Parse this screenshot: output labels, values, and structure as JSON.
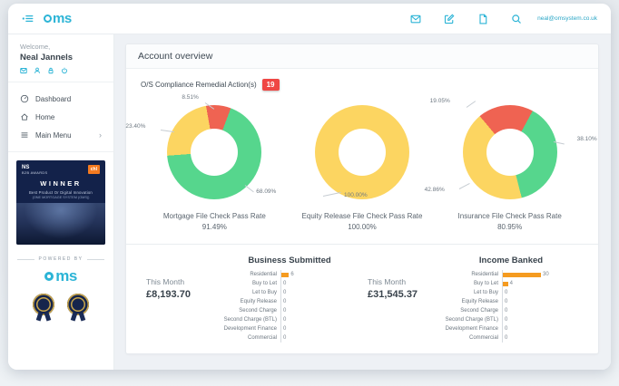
{
  "brand": {
    "o": "o",
    "ms": "ms"
  },
  "topbar": {
    "email": "neal@omsystem.co.uk"
  },
  "sidebar": {
    "welcome": "Welcome,",
    "username": "Neal Jannels",
    "nav": [
      {
        "label": "Dashboard"
      },
      {
        "label": "Home"
      },
      {
        "label": "Main Menu",
        "chevron": "›"
      }
    ],
    "award_banner": {
      "org": "NS",
      "org_sub": "B2B AWARDS",
      "sponsor": "chl",
      "winner": "WINNER",
      "category": "Best Product Or Digital Innovation",
      "product": "(ONE MORTGAGE SYSTEM (OMS))"
    },
    "powered_by": "POWERED BY"
  },
  "main": {
    "page_title": "Account overview",
    "compliance_label": "O/S Compliance Remedial Action(s)",
    "compliance_count": "19"
  },
  "chart_data": {
    "donuts": [
      {
        "type": "pie",
        "title": "Mortgage File Check Pass Rate",
        "value": "91.49%",
        "rotation": -10,
        "segments": [
          {
            "label": "8.51%",
            "value": 8.51,
            "color": "#ef6352"
          },
          {
            "label": "68.09%",
            "value": 68.09,
            "color": "#56d68d"
          },
          {
            "label": "23.40%",
            "value": 23.4,
            "color": "#fcd561"
          }
        ]
      },
      {
        "type": "pie",
        "title": "Equity Release File Check Pass Rate",
        "value": "100.00%",
        "rotation": 0,
        "segments": [
          {
            "label": "100.00%",
            "value": 100,
            "color": "#fcd561"
          }
        ]
      },
      {
        "type": "pie",
        "title": "Insurance File Check Pass Rate",
        "value": "80.95%",
        "rotation": -40,
        "segments": [
          {
            "label": "19.05%",
            "value": 19.05,
            "color": "#ef6352"
          },
          {
            "label": "38.10%",
            "value": 38.1,
            "color": "#56d68d"
          },
          {
            "label": "42.86%",
            "value": 42.86,
            "color": "#fcd561"
          }
        ]
      }
    ],
    "bar_charts": [
      {
        "type": "bar",
        "title": "Business Submitted",
        "period_label": "This Month",
        "period_value": "£8,193.70",
        "categories": [
          "Residential",
          "Buy to Let",
          "Let to Buy",
          "Equity Release",
          "Second Charge",
          "Second Charge (BTL)",
          "Development Finance",
          "Commercial"
        ],
        "values": [
          6,
          0,
          0,
          0,
          0,
          0,
          0,
          0
        ],
        "bar_color": "#f59b20"
      },
      {
        "type": "bar",
        "title": "Income Banked",
        "period_label": "This Month",
        "period_value": "£31,545.37",
        "categories": [
          "Residential",
          "Buy to Let",
          "Let to Buy",
          "Equity Release",
          "Second Charge",
          "Second Charge (BTL)",
          "Development Finance",
          "Commercial"
        ],
        "values": [
          30,
          4,
          0,
          0,
          0,
          0,
          0,
          0
        ],
        "bar_color": "#f59b20"
      }
    ]
  }
}
